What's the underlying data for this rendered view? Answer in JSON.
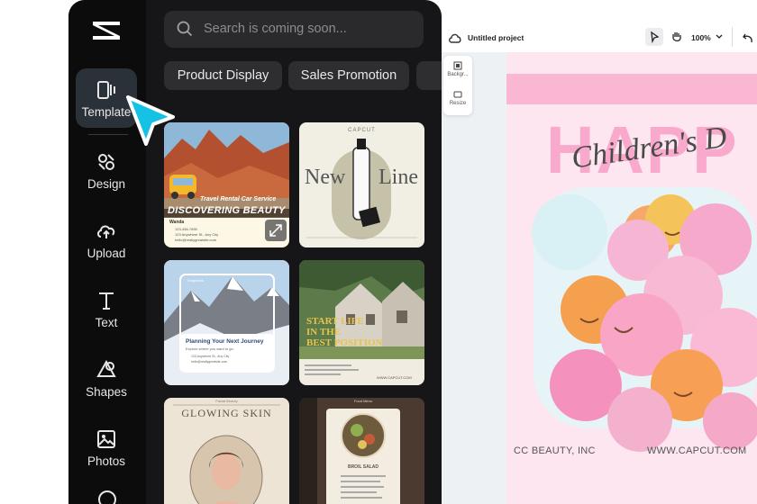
{
  "sidebar": {
    "items": [
      {
        "label": "Template",
        "icon": "template-icon",
        "active": true
      },
      {
        "label": "Design",
        "icon": "design-icon"
      },
      {
        "label": "Upload",
        "icon": "upload-icon"
      },
      {
        "label": "Text",
        "icon": "text-icon"
      },
      {
        "label": "Shapes",
        "icon": "shapes-icon"
      },
      {
        "label": "Photos",
        "icon": "photos-icon"
      }
    ]
  },
  "search": {
    "placeholder": "Search is coming soon..."
  },
  "chips": [
    "Product Display",
    "Sales Promotion"
  ],
  "templates": {
    "card1": {
      "brand": "Travel Rental Car Service",
      "headline": "DISCOVERING BEAUTY",
      "subtitle": "Wanda",
      "lines": [
        "123-456-7890",
        "123 Anywhere St., Any City",
        "hello@reallygreatsite.com"
      ]
    },
    "card2": {
      "brand": "CAPCUT",
      "word_left": "New",
      "word_right": "Line"
    },
    "card3": {
      "tag": "Snapbook",
      "title": "Planning Your Next Journey",
      "subtitle": "Explore where you want to go.",
      "lines": [
        "123 Anywhere St., Any City",
        "hello@reallygreatsite.com"
      ]
    },
    "card4": {
      "title_line1": "START LIFE",
      "title_line2": "IN THE",
      "title_line3": "BEST POSITION",
      "url": "WWW.CAPCUT.COM"
    },
    "card5": {
      "title": "GLOWING SKIN",
      "brand": "Facial Beauty"
    },
    "card6": {
      "title": "Food Menu",
      "dish": "BROIL SALAD"
    }
  },
  "editor": {
    "project_title": "Untitled project",
    "zoom": "100%",
    "tools": [
      "Backgr...",
      "Resize"
    ],
    "canvas": {
      "headline": "HAPP",
      "script": "Children's D",
      "footer_left": "CC BEAUTY, INC",
      "footer_right": "WWW.CAPCUT.COM"
    }
  },
  "colors": {
    "sidebar_bg": "#0c0c0d",
    "panel_bg": "#161618",
    "cursor": "#19c1e6",
    "canvas_pink": "#fde6ef",
    "headline_pink": "#f9a9cc"
  }
}
